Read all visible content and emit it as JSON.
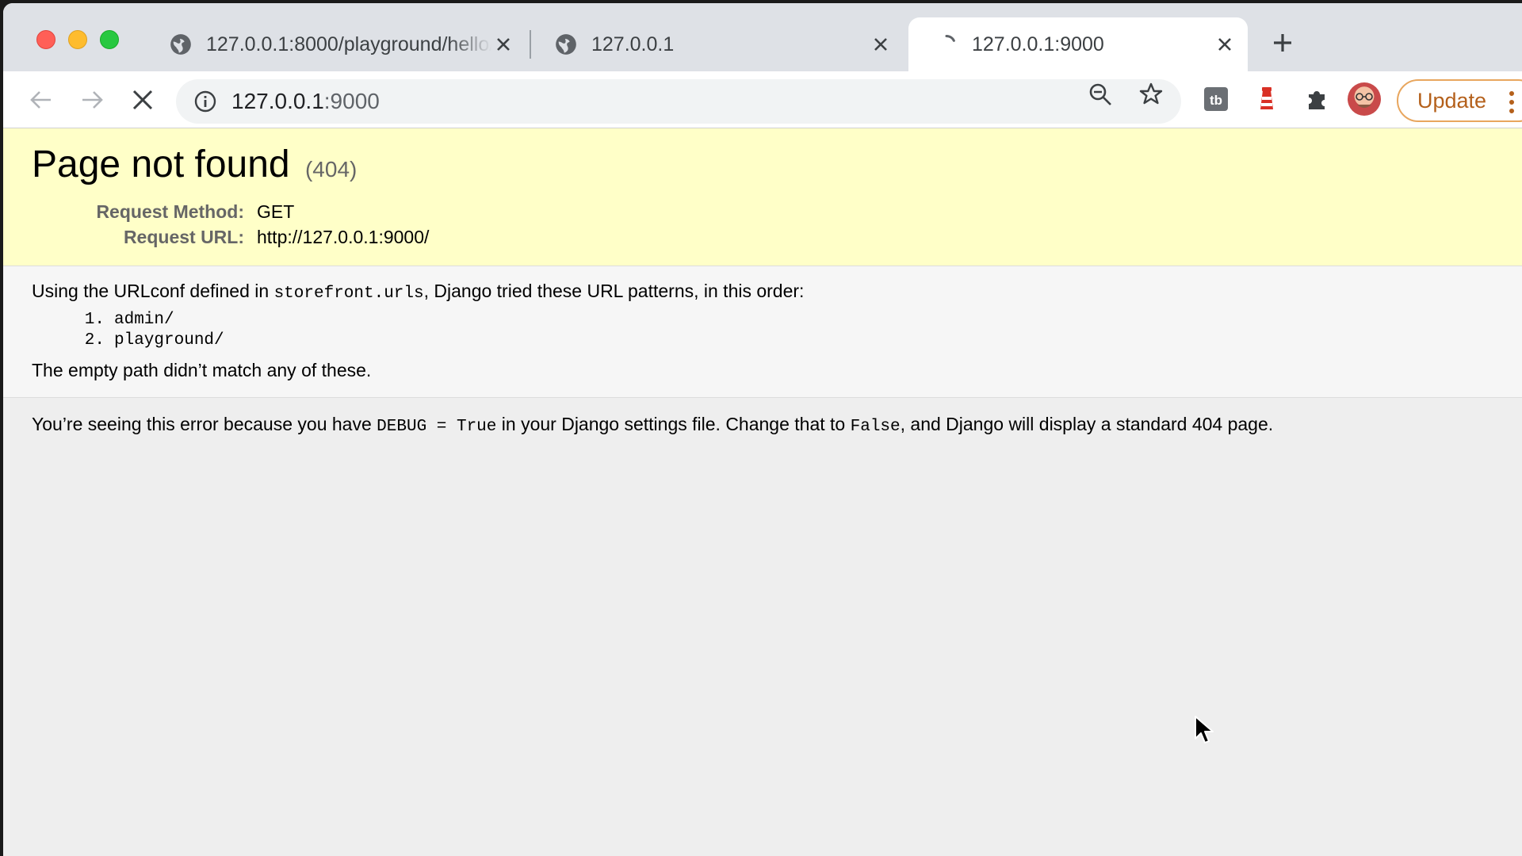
{
  "browser": {
    "tabs": [
      {
        "title": "127.0.0.1:8000/playground/hello/",
        "favicon": "globe-icon",
        "active": false
      },
      {
        "title": "127.0.0.1",
        "favicon": "globe-icon",
        "active": false
      },
      {
        "title": "127.0.0.1:9000",
        "favicon": "loading-spinner-icon",
        "active": true
      }
    ],
    "address": {
      "host": "127.0.0.1",
      "port": ":9000"
    },
    "update_label": "Update"
  },
  "page": {
    "title": "Page not found",
    "status_code": "(404)",
    "request_method_label": "Request Method:",
    "request_method": "GET",
    "request_url_label": "Request URL:",
    "request_url": "http://127.0.0.1:9000/",
    "urlconf_text_before": "Using the URLconf defined in ",
    "urlconf_module": "storefront.urls",
    "urlconf_text_after": ", Django tried these URL patterns, in this order:",
    "patterns": [
      {
        "num": "1.",
        "pattern": "admin/"
      },
      {
        "num": "2.",
        "pattern": "playground/"
      }
    ],
    "no_match": "The empty path didn’t match any of these.",
    "debug_text_1": "You’re seeing this error because you have ",
    "debug_code": "DEBUG = True",
    "debug_text_2": " in your Django settings file. Change that to ",
    "false_code": "False",
    "debug_text_3": ", and Django will display a standard 404 page."
  },
  "colors": {
    "summary_bg": "#ffffc8",
    "update_accent": "#b4601b"
  }
}
